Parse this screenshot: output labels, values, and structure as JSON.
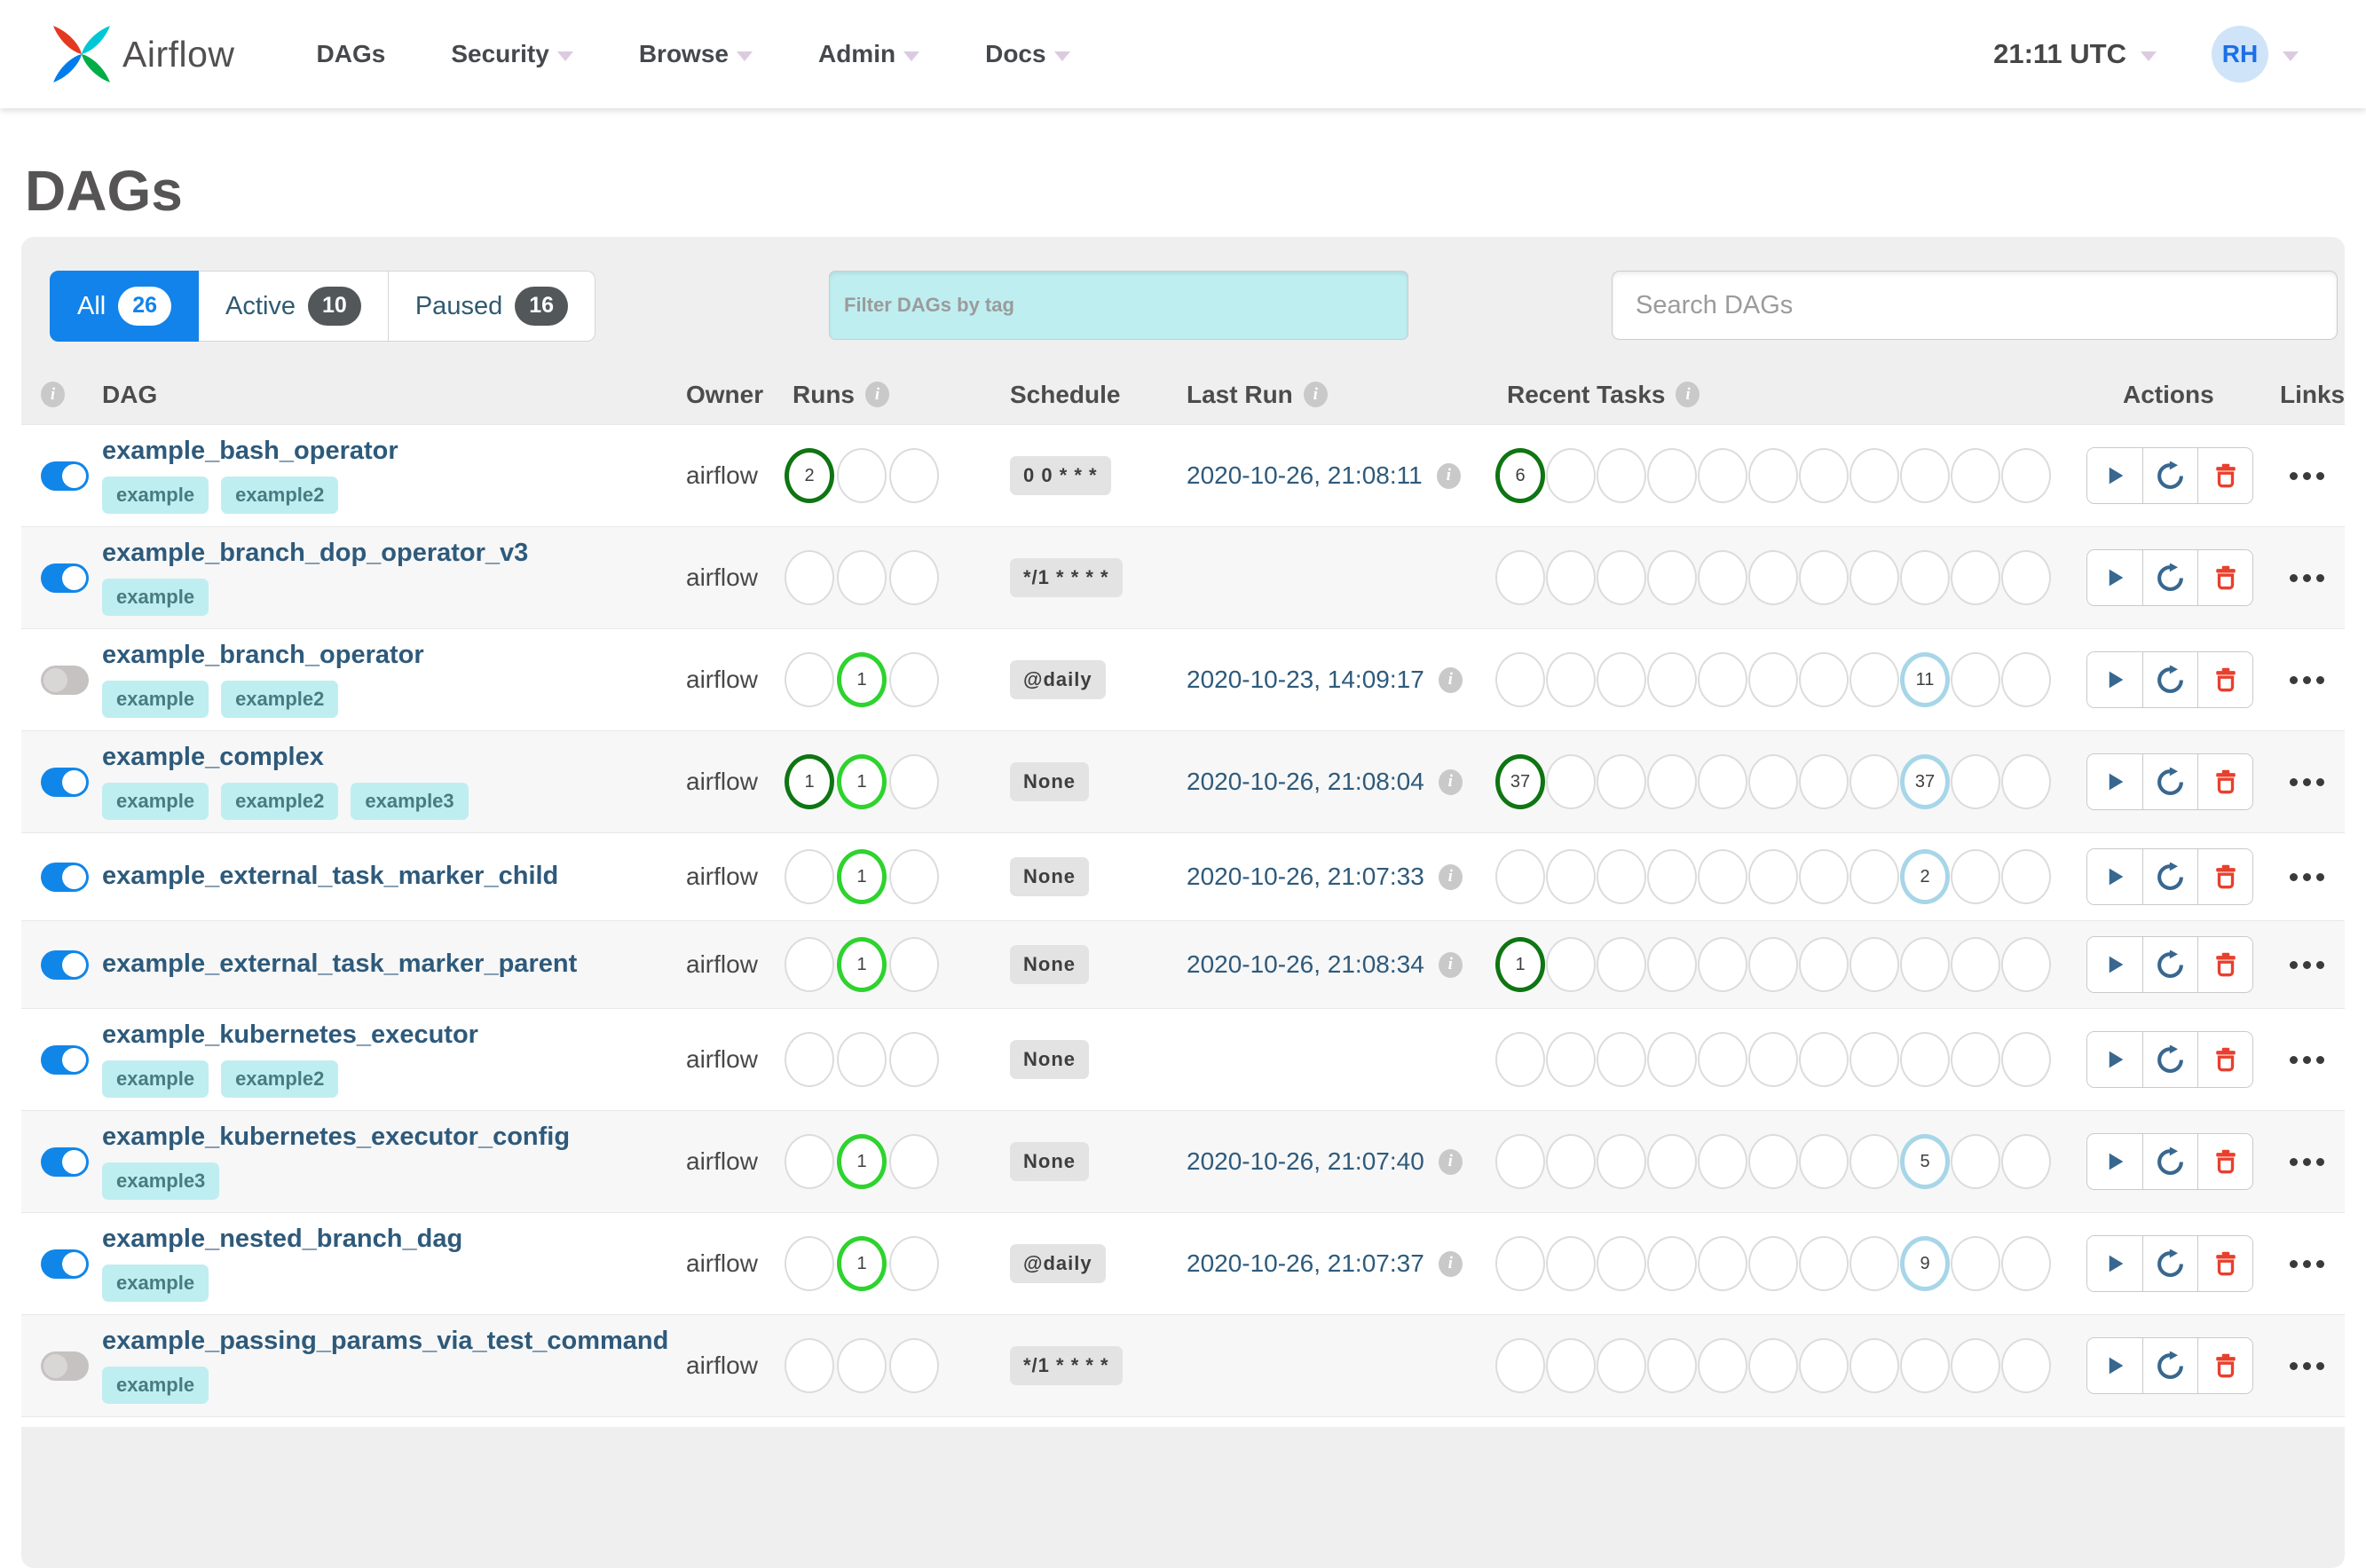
{
  "navbar": {
    "brand": "Airflow",
    "menu": [
      {
        "label": "DAGs",
        "dropdown": false
      },
      {
        "label": "Security",
        "dropdown": true
      },
      {
        "label": "Browse",
        "dropdown": true
      },
      {
        "label": "Admin",
        "dropdown": true
      },
      {
        "label": "Docs",
        "dropdown": true
      }
    ],
    "clock": "21:11 UTC",
    "avatar_initials": "RH"
  },
  "page_title": "DAGs",
  "tabs": [
    {
      "label": "All",
      "count": "26",
      "active": true
    },
    {
      "label": "Active",
      "count": "10",
      "active": false
    },
    {
      "label": "Paused",
      "count": "16",
      "active": false
    }
  ],
  "filters": {
    "tag_placeholder": "Filter DAGs by tag",
    "search_placeholder": "Search DAGs"
  },
  "table": {
    "headers": {
      "dag": "DAG",
      "owner": "Owner",
      "runs": "Runs",
      "schedule": "Schedule",
      "last_run": "Last Run",
      "recent_tasks": "Recent Tasks",
      "actions": "Actions",
      "links": "Links"
    },
    "runs_slots": 3,
    "recent_slots": 11,
    "rows": [
      {
        "name": "example_bash_operator",
        "tags": [
          "example",
          "example2"
        ],
        "enabled": true,
        "owner": "airflow",
        "runs": [
          {
            "slot": 1,
            "state": "success",
            "count": "2"
          }
        ],
        "schedule": "0 0 * * *",
        "last_run": "2020-10-26, 21:08:11",
        "recent": [
          {
            "slot": 1,
            "state": "success",
            "count": "6"
          }
        ]
      },
      {
        "name": "example_branch_dop_operator_v3",
        "tags": [
          "example"
        ],
        "enabled": true,
        "owner": "airflow",
        "runs": [],
        "schedule": "*/1 * * * *",
        "last_run": "",
        "recent": []
      },
      {
        "name": "example_branch_operator",
        "tags": [
          "example",
          "example2"
        ],
        "enabled": false,
        "owner": "airflow",
        "runs": [
          {
            "slot": 2,
            "state": "running",
            "count": "1"
          }
        ],
        "schedule": "@daily",
        "last_run": "2020-10-23, 14:09:17",
        "recent": [
          {
            "slot": 9,
            "state": "none",
            "count": "11"
          }
        ]
      },
      {
        "name": "example_complex",
        "tags": [
          "example",
          "example2",
          "example3"
        ],
        "enabled": true,
        "owner": "airflow",
        "runs": [
          {
            "slot": 1,
            "state": "success",
            "count": "1"
          },
          {
            "slot": 2,
            "state": "running",
            "count": "1"
          }
        ],
        "schedule": "None",
        "last_run": "2020-10-26, 21:08:04",
        "recent": [
          {
            "slot": 1,
            "state": "success",
            "count": "37"
          },
          {
            "slot": 9,
            "state": "none",
            "count": "37"
          }
        ]
      },
      {
        "name": "example_external_task_marker_child",
        "tags": [],
        "enabled": true,
        "owner": "airflow",
        "runs": [
          {
            "slot": 2,
            "state": "running",
            "count": "1"
          }
        ],
        "schedule": "None",
        "last_run": "2020-10-26, 21:07:33",
        "recent": [
          {
            "slot": 9,
            "state": "none",
            "count": "2"
          }
        ]
      },
      {
        "name": "example_external_task_marker_parent",
        "tags": [],
        "enabled": true,
        "owner": "airflow",
        "runs": [
          {
            "slot": 2,
            "state": "running",
            "count": "1"
          }
        ],
        "schedule": "None",
        "last_run": "2020-10-26, 21:08:34",
        "recent": [
          {
            "slot": 1,
            "state": "success",
            "count": "1"
          }
        ]
      },
      {
        "name": "example_kubernetes_executor",
        "tags": [
          "example",
          "example2"
        ],
        "enabled": true,
        "owner": "airflow",
        "runs": [],
        "schedule": "None",
        "last_run": "",
        "recent": []
      },
      {
        "name": "example_kubernetes_executor_config",
        "tags": [
          "example3"
        ],
        "enabled": true,
        "owner": "airflow",
        "runs": [
          {
            "slot": 2,
            "state": "running",
            "count": "1"
          }
        ],
        "schedule": "None",
        "last_run": "2020-10-26, 21:07:40",
        "recent": [
          {
            "slot": 9,
            "state": "none",
            "count": "5"
          }
        ]
      },
      {
        "name": "example_nested_branch_dag",
        "tags": [
          "example"
        ],
        "enabled": true,
        "owner": "airflow",
        "runs": [
          {
            "slot": 2,
            "state": "running",
            "count": "1"
          }
        ],
        "schedule": "@daily",
        "last_run": "2020-10-26, 21:07:37",
        "recent": [
          {
            "slot": 9,
            "state": "none",
            "count": "9"
          }
        ]
      },
      {
        "name": "example_passing_params_via_test_command",
        "tags": [
          "example"
        ],
        "enabled": false,
        "owner": "airflow",
        "runs": [],
        "schedule": "*/1 * * * *",
        "last_run": "",
        "recent": []
      }
    ]
  },
  "icons": {
    "info_glyph": "i",
    "play": "play-icon",
    "refresh": "refresh-icon",
    "delete": "trash-icon",
    "links": "ellipsis-icon",
    "info": "info-icon"
  },
  "colors": {
    "accent": "#1283ea",
    "success": "#0e7512",
    "running": "#2ed32e",
    "none_state": "#a7d6e8",
    "link": "#2e5a7b",
    "toggle_on": "#1086e9",
    "tag_bg": "#bfeef1",
    "tag_text": "#477c80",
    "trash_red": "#e8402d",
    "icon_blue": "#38678f"
  }
}
